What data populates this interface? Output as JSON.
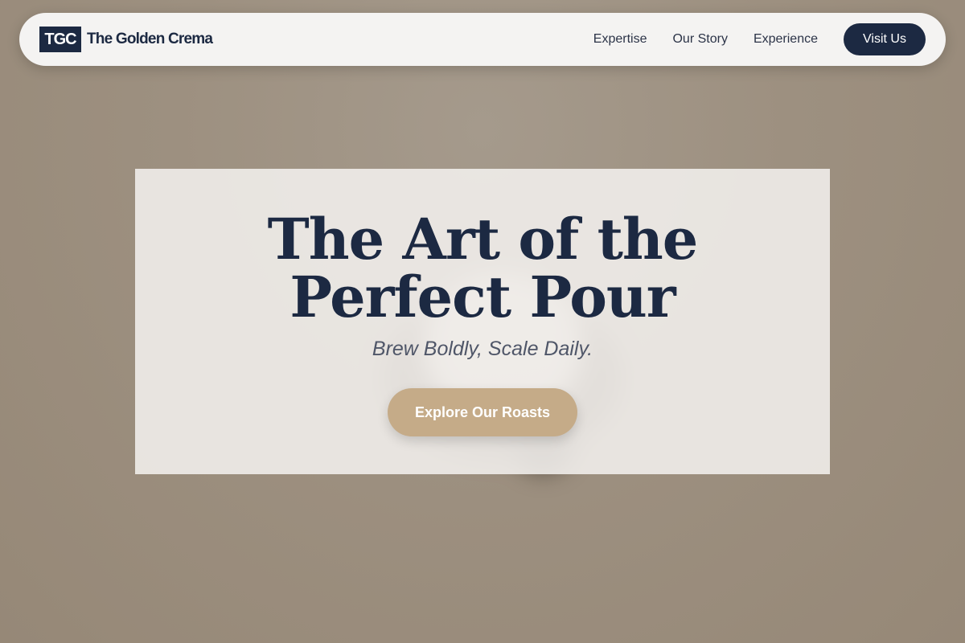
{
  "brand": {
    "mark": "TGC",
    "name": "The Golden Crema"
  },
  "nav": {
    "links": [
      "Expertise",
      "Our Story",
      "Experience"
    ],
    "cta_label": "Visit Us"
  },
  "hero": {
    "title": "The Art of the Perfect Pour",
    "subtitle": "Brew Boldly, Scale Daily.",
    "cta_label": "Explore Our Roasts"
  },
  "colors": {
    "navy": "#1c2942",
    "gold": "#c5ab88",
    "background": "#9d9080",
    "card": "#f4f2f0"
  }
}
